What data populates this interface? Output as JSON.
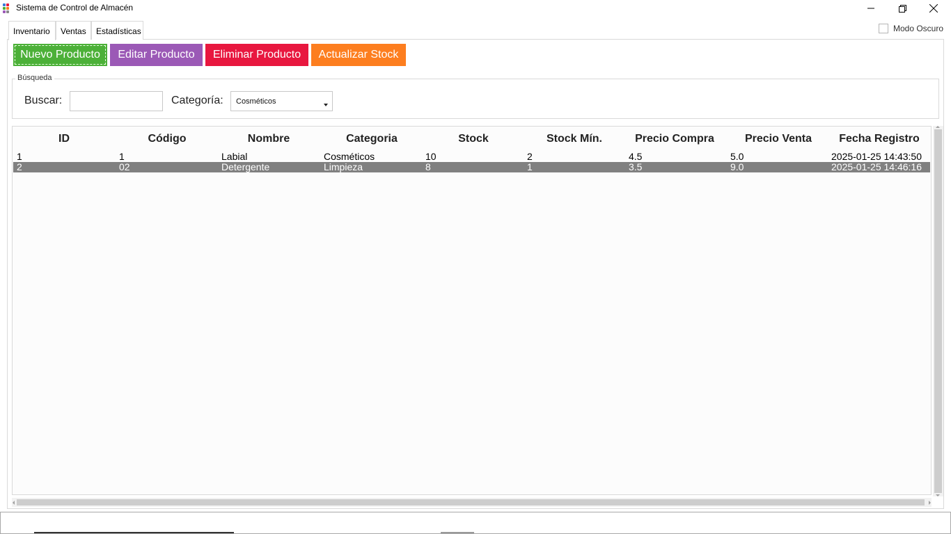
{
  "window": {
    "title": "Sistema de Control de Almacén",
    "icon": "app-grid-icon"
  },
  "tabs": [
    {
      "label": "Inventario",
      "active": true
    },
    {
      "label": "Ventas",
      "active": false
    },
    {
      "label": "Estadísticas",
      "active": false
    }
  ],
  "dark_mode": {
    "label": "Modo Oscuro",
    "checked": false
  },
  "toolbar": {
    "new_label": "Nuevo Producto",
    "edit_label": "Editar Producto",
    "delete_label": "Eliminar Producto",
    "stock_label": "Actualizar Stock",
    "colors": {
      "new": "#4cb038",
      "edit": "#9b59b6",
      "delete": "#e8173f",
      "stock": "#fd7e1f"
    }
  },
  "search": {
    "group_label": "Búsqueda",
    "search_label": "Buscar:",
    "search_value": "",
    "category_label": "Categoría:",
    "category_value": "Cosméticos"
  },
  "table": {
    "columns": [
      "ID",
      "Código",
      "Nombre",
      "Categoria",
      "Stock",
      "Stock Mín.",
      "Precio Compra",
      "Precio Venta",
      "Fecha Registro"
    ],
    "rows": [
      {
        "id": "1",
        "codigo": "1",
        "nombre": "Labial",
        "categoria": "Cosméticos",
        "stock": "10",
        "stock_min": "2",
        "precio_compra": "4.5",
        "precio_venta": "5.0",
        "fecha": "2025-01-25 14:43:50",
        "selected": false
      },
      {
        "id": "2",
        "codigo": "02",
        "nombre": "Detergente",
        "categoria": "Limpieza",
        "stock": "8",
        "stock_min": "1",
        "precio_compra": "3.5",
        "precio_venta": "9.0",
        "fecha": "2025-01-25 14:46:16",
        "selected": true
      }
    ]
  }
}
